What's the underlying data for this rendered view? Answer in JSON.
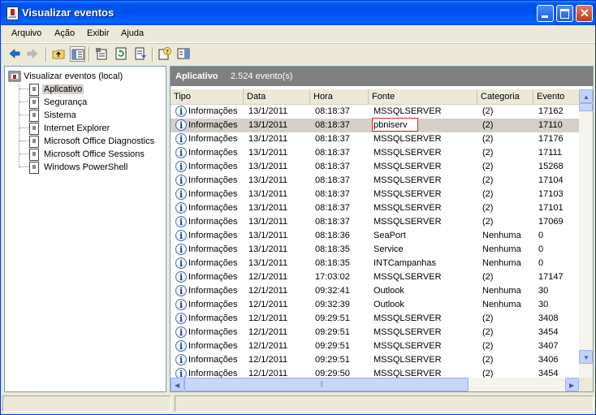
{
  "window": {
    "title": "Visualizar eventos"
  },
  "menu": [
    "Arquivo",
    "Ação",
    "Exibir",
    "Ajuda"
  ],
  "toolbar": [
    "back-icon",
    "forward-icon",
    "up-folder-icon",
    "show-hide-tree-icon",
    "properties-icon",
    "refresh-icon",
    "export-list-icon",
    "help-icon",
    "show-hide-action-pane-icon"
  ],
  "tree": {
    "root": "Visualizar eventos (local)",
    "items": [
      "Aplicativo",
      "Segurança",
      "Sistema",
      "Internet Explorer",
      "Microsoft Office Diagnostics",
      "Microsoft Office Sessions",
      "Windows PowerShell"
    ],
    "selected": "Aplicativo"
  },
  "panel": {
    "title": "Aplicativo",
    "count": "2.524 evento(s)"
  },
  "columns": [
    "Tipo",
    "Data",
    "Hora",
    "Fonte",
    "Categoria",
    "Evento"
  ],
  "rows": [
    {
      "tipo": "Informações",
      "data": "13/1/2011",
      "hora": "08:18:37",
      "fonte": "MSSQLSERVER",
      "cat": "(2)",
      "ev": "17162"
    },
    {
      "tipo": "Informações",
      "data": "13/1/2011",
      "hora": "08:18:37",
      "fonte": "pbniserv",
      "cat": "(2)",
      "ev": "17110"
    },
    {
      "tipo": "Informações",
      "data": "13/1/2011",
      "hora": "08:18:37",
      "fonte": "MSSQLSERVER",
      "cat": "(2)",
      "ev": "17176"
    },
    {
      "tipo": "Informações",
      "data": "13/1/2011",
      "hora": "08:18:37",
      "fonte": "MSSQLSERVER",
      "cat": "(2)",
      "ev": "17111"
    },
    {
      "tipo": "Informações",
      "data": "13/1/2011",
      "hora": "08:18:37",
      "fonte": "MSSQLSERVER",
      "cat": "(2)",
      "ev": "15268"
    },
    {
      "tipo": "Informações",
      "data": "13/1/2011",
      "hora": "08:18:37",
      "fonte": "MSSQLSERVER",
      "cat": "(2)",
      "ev": "17104"
    },
    {
      "tipo": "Informações",
      "data": "13/1/2011",
      "hora": "08:18:37",
      "fonte": "MSSQLSERVER",
      "cat": "(2)",
      "ev": "17103"
    },
    {
      "tipo": "Informações",
      "data": "13/1/2011",
      "hora": "08:18:37",
      "fonte": "MSSQLSERVER",
      "cat": "(2)",
      "ev": "17101"
    },
    {
      "tipo": "Informações",
      "data": "13/1/2011",
      "hora": "08:18:37",
      "fonte": "MSSQLSERVER",
      "cat": "(2)",
      "ev": "17069"
    },
    {
      "tipo": "Informações",
      "data": "13/1/2011",
      "hora": "08:18:36",
      "fonte": "SeaPort",
      "cat": "Nenhuma",
      "ev": "0"
    },
    {
      "tipo": "Informações",
      "data": "13/1/2011",
      "hora": "08:18:35",
      "fonte": "Service",
      "cat": "Nenhuma",
      "ev": "0"
    },
    {
      "tipo": "Informações",
      "data": "13/1/2011",
      "hora": "08:18:35",
      "fonte": "INTCampanhas",
      "cat": "Nenhuma",
      "ev": "0"
    },
    {
      "tipo": "Informações",
      "data": "12/1/2011",
      "hora": "17:03:02",
      "fonte": "MSSQLSERVER",
      "cat": "(2)",
      "ev": "17147"
    },
    {
      "tipo": "Informações",
      "data": "12/1/2011",
      "hora": "09:32:41",
      "fonte": "Outlook",
      "cat": "Nenhuma",
      "ev": "30"
    },
    {
      "tipo": "Informações",
      "data": "12/1/2011",
      "hora": "09:32:39",
      "fonte": "Outlook",
      "cat": "Nenhuma",
      "ev": "30"
    },
    {
      "tipo": "Informações",
      "data": "12/1/2011",
      "hora": "09:29:51",
      "fonte": "MSSQLSERVER",
      "cat": "(2)",
      "ev": "3408"
    },
    {
      "tipo": "Informações",
      "data": "12/1/2011",
      "hora": "09:29:51",
      "fonte": "MSSQLSERVER",
      "cat": "(2)",
      "ev": "3454"
    },
    {
      "tipo": "Informações",
      "data": "12/1/2011",
      "hora": "09:29:51",
      "fonte": "MSSQLSERVER",
      "cat": "(2)",
      "ev": "3407"
    },
    {
      "tipo": "Informações",
      "data": "12/1/2011",
      "hora": "09:29:51",
      "fonte": "MSSQLSERVER",
      "cat": "(2)",
      "ev": "3406"
    },
    {
      "tipo": "Informações",
      "data": "12/1/2011",
      "hora": "09:29:50",
      "fonte": "MSSQLSERVER",
      "cat": "(2)",
      "ev": "3454"
    }
  ],
  "selected_row": 1,
  "highlight_color": "#e0262b"
}
